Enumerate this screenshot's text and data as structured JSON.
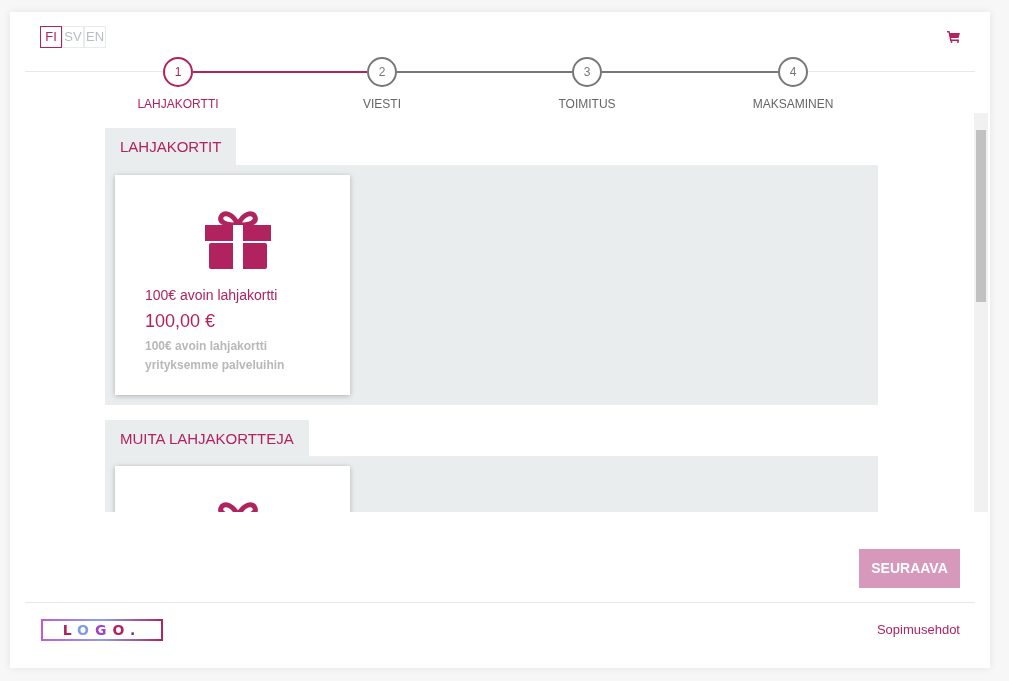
{
  "languages": [
    {
      "label": "FI",
      "selected": true
    },
    {
      "label": "SV",
      "selected": false
    },
    {
      "label": "EN",
      "selected": false
    }
  ],
  "steps": [
    {
      "number": "1",
      "label": "LAHJAKORTTI",
      "selected": true
    },
    {
      "number": "2",
      "label": "VIESTI",
      "selected": false
    },
    {
      "number": "3",
      "label": "TOIMITUS",
      "selected": false
    },
    {
      "number": "4",
      "label": "MAKSAMINEN",
      "selected": false
    }
  ],
  "sections": [
    {
      "title": "LAHJAKORTIT",
      "cards": [
        {
          "kind": "gift",
          "name": "100€ avoin lahjakortti",
          "price": "100,00 €",
          "description": "100€ avoin lahjakortti yrityksemme palveluihin"
        }
      ]
    },
    {
      "title": "MUITA LAHJAKORTTEJA",
      "cards": [
        {
          "kind": "gift"
        }
      ]
    }
  ],
  "next_button": {
    "label": "SEURAAVA",
    "disabled": true
  },
  "footer": {
    "logo": "LOGO.",
    "link": "Sopimusehdot"
  }
}
